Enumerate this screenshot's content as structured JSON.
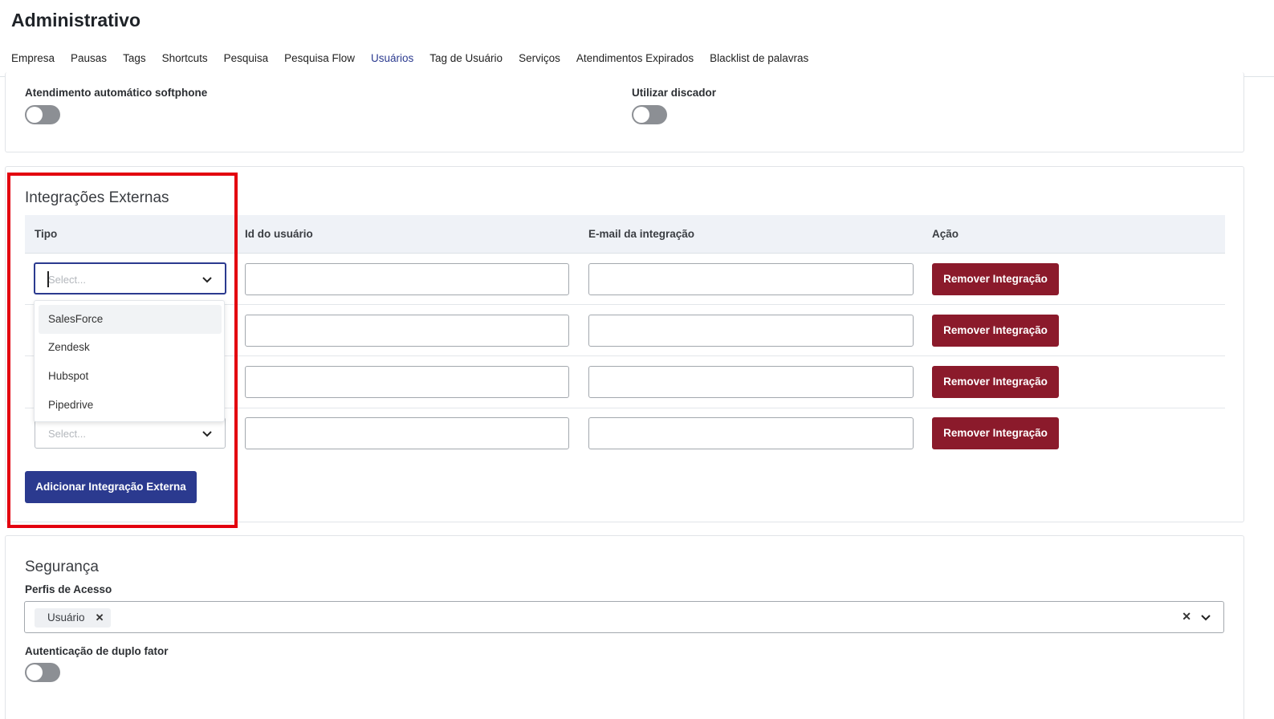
{
  "page": {
    "title": "Administrativo"
  },
  "tabs": [
    {
      "label": "Empresa"
    },
    {
      "label": "Pausas"
    },
    {
      "label": "Tags"
    },
    {
      "label": "Shortcuts"
    },
    {
      "label": "Pesquisa"
    },
    {
      "label": "Pesquisa Flow"
    },
    {
      "label": "Usuários",
      "active": true
    },
    {
      "label": "Tag de Usuário"
    },
    {
      "label": "Serviços"
    },
    {
      "label": "Atendimentos Expirados"
    },
    {
      "label": "Blacklist de palavras"
    }
  ],
  "softphone": {
    "auto_answer_label": "Atendimento automático softphone",
    "auto_answer_on": false,
    "dialer_label": "Utilizar discador",
    "dialer_on": false
  },
  "integrations": {
    "title": "Integrações Externas",
    "columns": {
      "tipo": "Tipo",
      "user_id": "Id do usuário",
      "email": "E-mail da integração",
      "action": "Ação"
    },
    "select_placeholder": "Select...",
    "remove_label": "Remover Integração",
    "add_label": "Adicionar Integração Externa",
    "dropdown_options": [
      "SalesForce",
      "Zendesk",
      "Hubspot",
      "Pipedrive"
    ],
    "hovered_option": "SalesForce",
    "rows": [
      {
        "user_id": "",
        "email": ""
      },
      {
        "user_id": "",
        "email": ""
      },
      {
        "user_id": "",
        "email": ""
      },
      {
        "user_id": "",
        "email": ""
      }
    ]
  },
  "security": {
    "title": "Segurança",
    "profiles_label": "Perfis de Acesso",
    "selected_profiles": [
      "Usuário"
    ],
    "two_factor_label": "Autenticação de duplo fator",
    "two_factor_on": false
  },
  "colors": {
    "primary": "#2b3a8f",
    "danger": "#8b1a2b",
    "highlight": "#e3000f",
    "toggle_off": "#8c8f94"
  }
}
